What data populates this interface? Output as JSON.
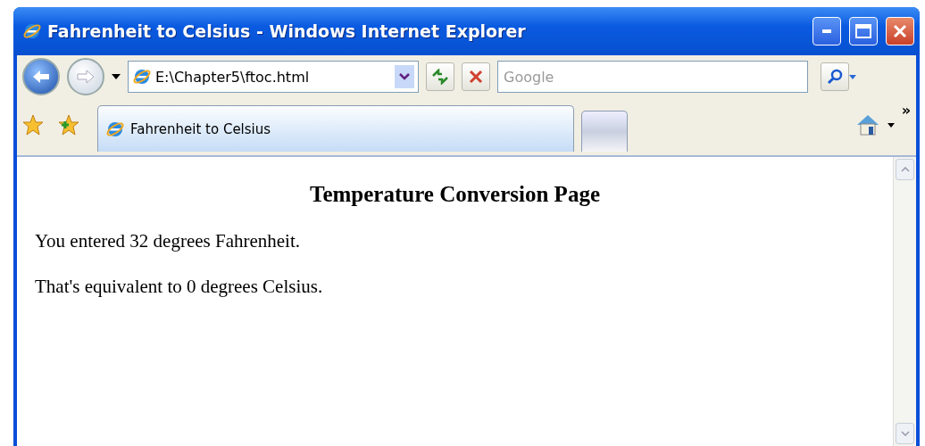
{
  "window": {
    "title": "Fahrenheit to Celsius - Windows Internet Explorer"
  },
  "address_bar": {
    "value": "E:\\Chapter5\\ftoc.html"
  },
  "search": {
    "placeholder": "Google"
  },
  "tabs": [
    {
      "kind": "page",
      "label": "Fahrenheit to Celsius",
      "selected": true
    },
    {
      "kind": "new",
      "selected": false
    }
  ],
  "more_tools": "»",
  "page": {
    "heading": "Temperature Conversion Page",
    "paragraphs": [
      "You entered 32 degrees Fahrenheit.",
      "That's equivalent to 0 degrees Celsius."
    ]
  }
}
